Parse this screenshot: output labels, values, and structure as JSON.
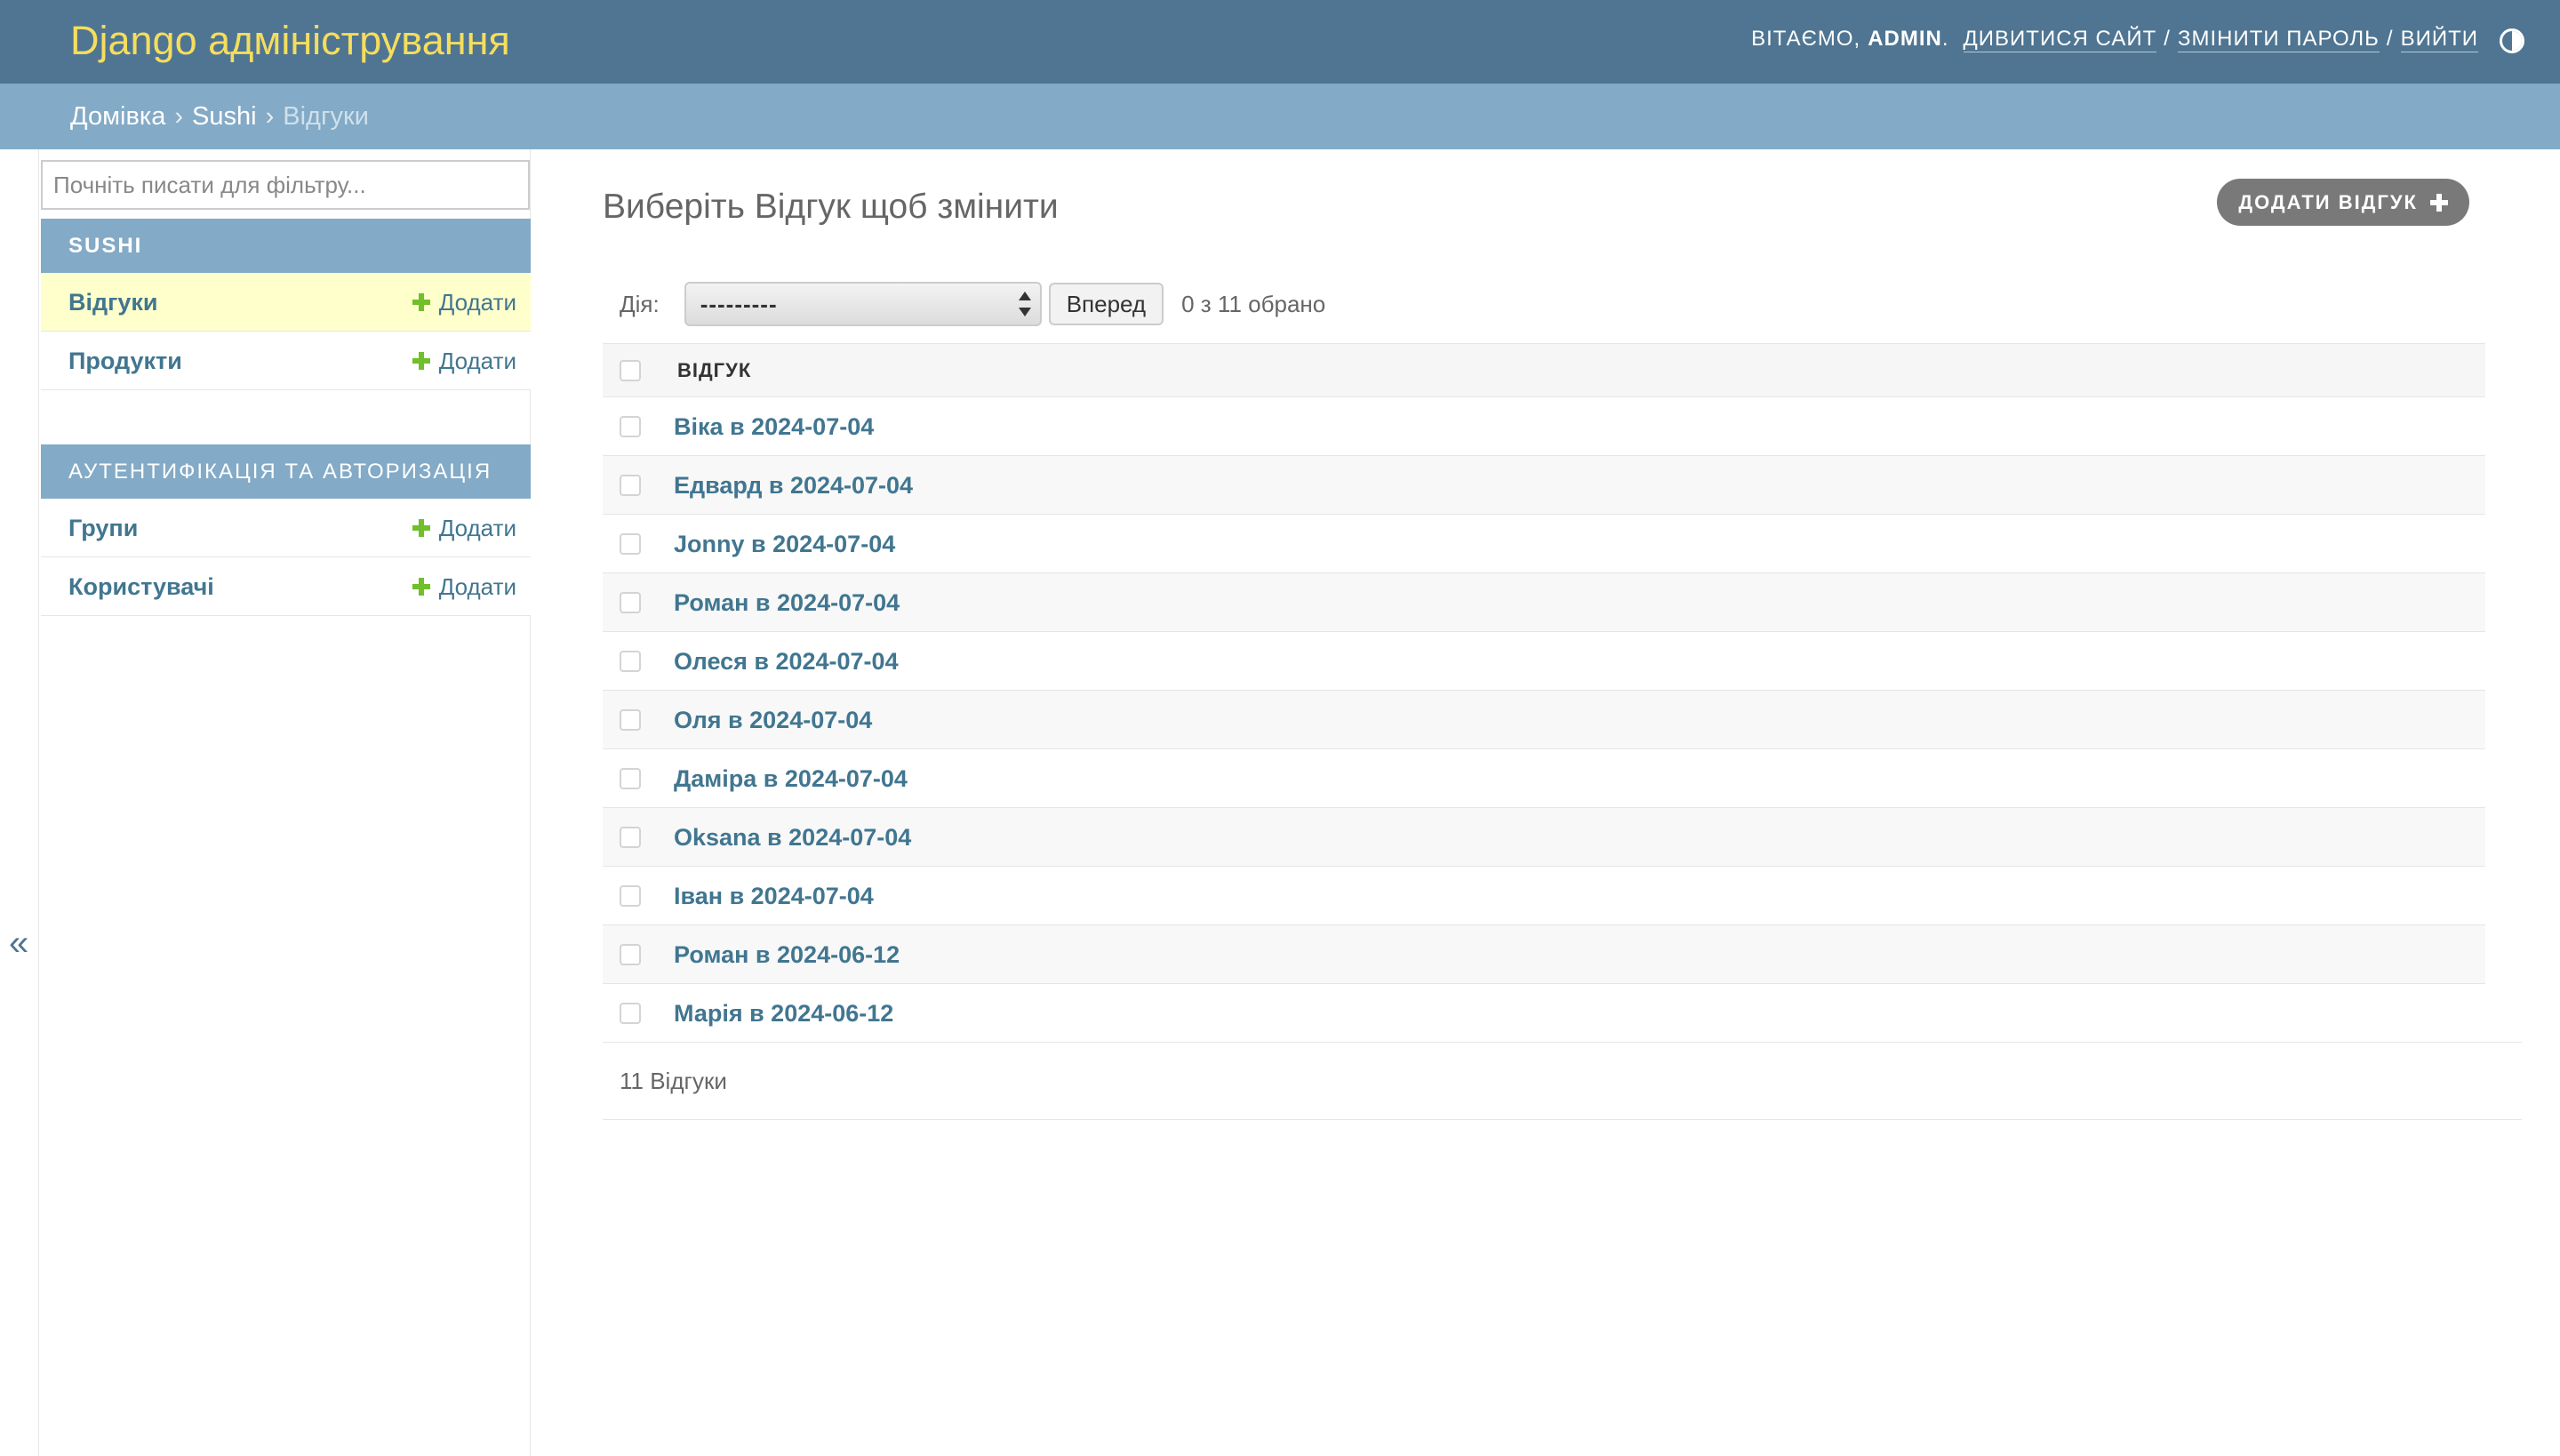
{
  "header": {
    "branding": "Django адміністрування",
    "user_tools": {
      "welcome": "Вітаємо,",
      "username": "admin",
      "view_site": "Дивитися сайт",
      "change_password": "Змінити пароль",
      "logout": "Вийти"
    }
  },
  "breadcrumbs": {
    "home": "Домівка",
    "app": "Sushi",
    "current": "Відгуки"
  },
  "sidebar": {
    "filter_placeholder": "Почніть писати для фільтру...",
    "collapse_glyph": "«",
    "apps": [
      {
        "caption": "Sushi",
        "models": [
          {
            "name": "Відгуки",
            "add": "Додати"
          },
          {
            "name": "Продукти",
            "add": "Додати"
          }
        ]
      },
      {
        "caption": "Аутентифікація та авторизація",
        "models": [
          {
            "name": "Групи",
            "add": "Додати"
          },
          {
            "name": "Користувачі",
            "add": "Додати"
          }
        ]
      }
    ]
  },
  "main": {
    "title": "Виберіть Відгук щоб змінити",
    "add_button": "Додати відгук",
    "actions": {
      "label": "Дія:",
      "selected": "---------",
      "go": "Вперед",
      "counter": "0 з 11 обрано"
    },
    "table": {
      "column": "Відгук",
      "rows": [
        "Віка в 2024-07-04",
        "Едвард в 2024-07-04",
        "Jonny в 2024-07-04",
        "Роман в 2024-07-04",
        "Олеся в 2024-07-04",
        "Оля в 2024-07-04",
        "Даміра в 2024-07-04",
        "Oksana в 2024-07-04",
        "Іван в 2024-07-04",
        "Роман в 2024-06-12",
        "Марія в 2024-06-12"
      ]
    },
    "paginator": "11 Відгуки"
  },
  "colors": {
    "header_bg": "#4f7592",
    "branding": "#f5dd5d",
    "breadcrumbs_bg": "#83aac6",
    "link": "#417690",
    "current_model_bg": "#ffffcc",
    "add_plus": "#70bf2b"
  }
}
